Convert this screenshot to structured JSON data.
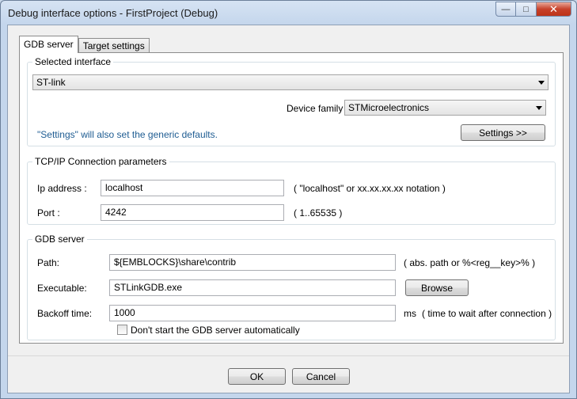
{
  "window": {
    "title": "Debug interface options - FirstProject (Debug)",
    "controls": {
      "minimize": "—",
      "maximize": "□",
      "close": "✕"
    }
  },
  "tabs": [
    {
      "label": "GDB server",
      "active": true
    },
    {
      "label": "Target settings",
      "active": false
    }
  ],
  "selected_interface": {
    "group_label": "Selected interface",
    "interface_value": "ST-link",
    "device_family_label": "Device family",
    "device_family_value": "STMicroelectronics",
    "note": "\"Settings\" will also set the generic defaults.",
    "settings_button": "Settings >>"
  },
  "tcpip": {
    "group_label": "TCP/IP Connection parameters",
    "ip_label": "Ip address :",
    "ip_value": "localhost",
    "ip_hint": "( \"localhost\" or xx.xx.xx.xx notation )",
    "port_label": "Port :",
    "port_value": "4242",
    "port_hint": "( 1..65535 )"
  },
  "gdb_server": {
    "group_label": "GDB server",
    "path_label": "Path:",
    "path_value": "${EMBLOCKS}\\share\\contrib",
    "path_hint": "( abs. path or %<reg__key>% )",
    "executable_label": "Executable:",
    "executable_value": "STLinkGDB.exe",
    "browse_button": "Browse",
    "backoff_label": "Backoff time:",
    "backoff_value": "1000",
    "backoff_unit": "ms",
    "backoff_hint": "( time to wait after connection )",
    "autostart_label": "Don't start the GDB server automatically",
    "autostart_checked": false
  },
  "footer": {
    "ok": "OK",
    "cancel": "Cancel"
  }
}
